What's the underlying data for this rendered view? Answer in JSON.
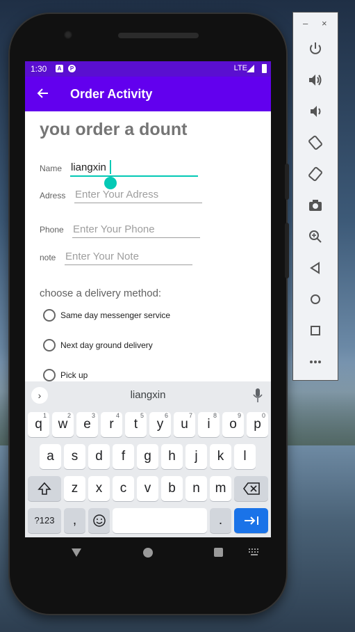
{
  "status_bar": {
    "time": "1:30",
    "network": "LTE",
    "icons": [
      "a-notification-icon",
      "p-notification-icon"
    ]
  },
  "app_bar": {
    "title": "Order Activity",
    "back_icon": "arrow-back-icon"
  },
  "form": {
    "heading": "you order a dount",
    "name": {
      "label": "Name",
      "value": "liangxin"
    },
    "address": {
      "label": "Adress",
      "placeholder": "Enter Your Adress"
    },
    "phone": {
      "label": "Phone",
      "placeholder": "Enter Your Phone"
    },
    "note": {
      "label": "note",
      "placeholder": "Enter Your Note"
    },
    "delivery_label": "choose a delivery method:",
    "delivery_options": [
      "Same day messenger service",
      "Next day ground delivery",
      "Pick up"
    ]
  },
  "keyboard": {
    "suggestion": "liangxin",
    "row1": [
      [
        "q",
        "1"
      ],
      [
        "w",
        "2"
      ],
      [
        "e",
        "3"
      ],
      [
        "r",
        "4"
      ],
      [
        "t",
        "5"
      ],
      [
        "y",
        "6"
      ],
      [
        "u",
        "7"
      ],
      [
        "i",
        "8"
      ],
      [
        "o",
        "9"
      ],
      [
        "p",
        "0"
      ]
    ],
    "row2": [
      "a",
      "s",
      "d",
      "f",
      "g",
      "h",
      "j",
      "k",
      "l"
    ],
    "row3": [
      "z",
      "x",
      "c",
      "v",
      "b",
      "n",
      "m"
    ],
    "symbols_key": "?123",
    "comma_key": ",",
    "period_key": "."
  },
  "emulator_toolbar": {
    "buttons": [
      "power-icon",
      "volume-up-icon",
      "volume-down-icon",
      "rotate-left-icon",
      "rotate-right-icon",
      "camera-icon",
      "zoom-icon",
      "back-icon",
      "home-icon",
      "overview-icon",
      "more-icon"
    ]
  },
  "colors": {
    "primary": "#6200ee",
    "status": "#5a0fd0",
    "accent": "#03c9b5",
    "key_action": "#1a73e8"
  }
}
